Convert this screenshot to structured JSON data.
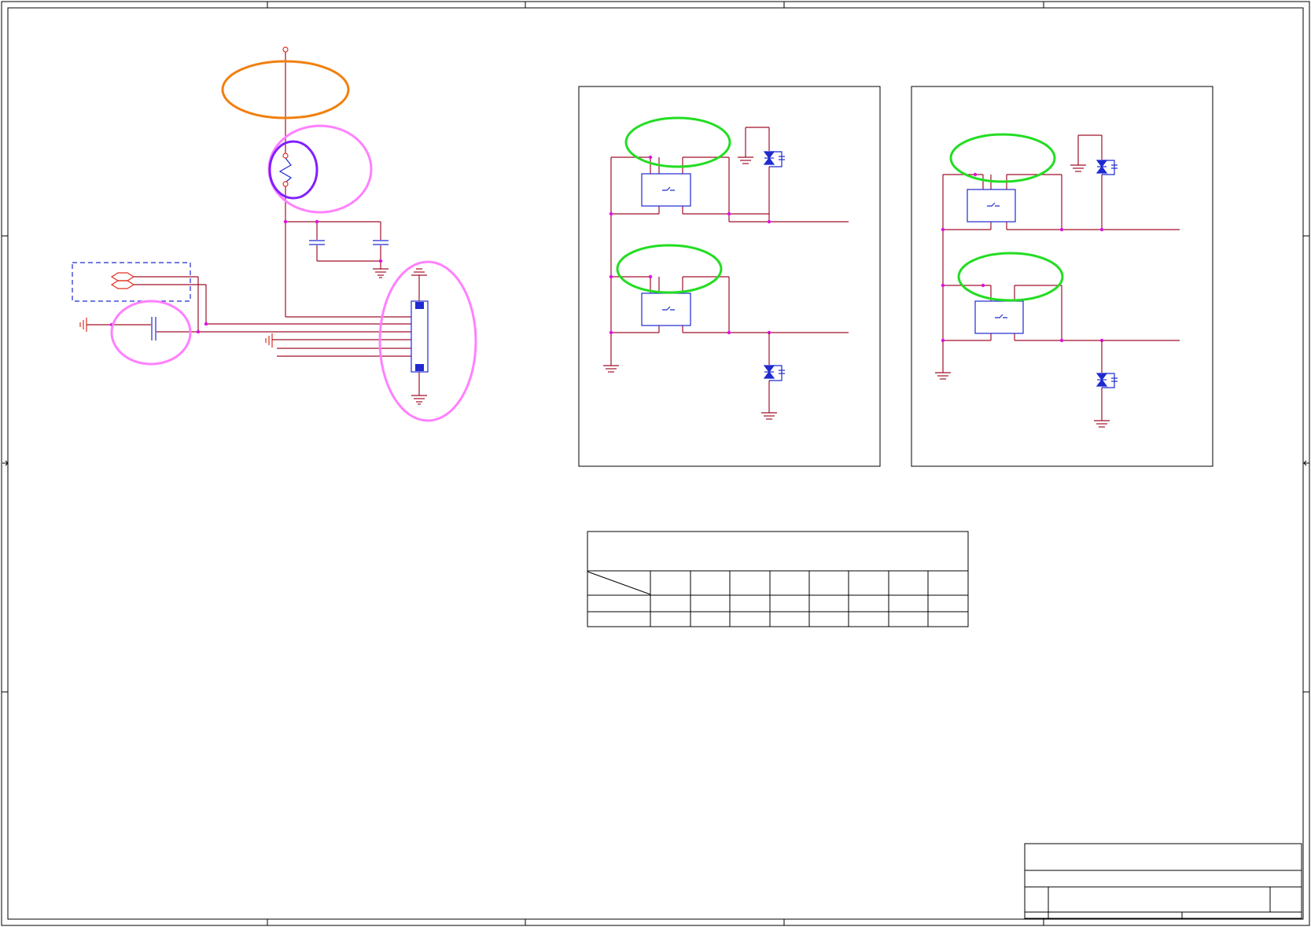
{
  "sheet": {
    "type": "electrical schematic sheet",
    "title_block_text": []
  },
  "colors": {
    "wire": "#a0102a",
    "junction": "#e010e0",
    "part_outline": "#1f2ad0",
    "frame": "#000000",
    "highlight_pink": "#ff80ff",
    "highlight_green": "#22dd22",
    "highlight_orange": "#f08010",
    "highlight_purple": "#8020ff",
    "ground_red": "#e03020"
  },
  "icons": {
    "ground": "ground-symbol-icon",
    "tvs": "tvs-diode-icon",
    "relay": "relay-switch-icon",
    "fuse": "fuse-icon",
    "capacitor": "capacitor-icon",
    "connector": "connector-icon",
    "antenna": "antenna-icon"
  },
  "table": {
    "columns": 9,
    "rows": 2
  }
}
